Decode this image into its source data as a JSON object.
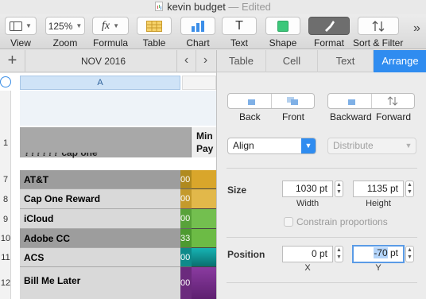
{
  "window": {
    "title": "kevin budget",
    "status": "Edited"
  },
  "toolbar": {
    "view": "View",
    "zoom_value": "125%",
    "zoom": "Zoom",
    "formula": "Formula",
    "formula_glyph": "fx",
    "table": "Table",
    "chart": "Chart",
    "text": "Text",
    "text_glyph": "T",
    "shape": "Shape",
    "format": "Format",
    "sort_filter": "Sort & Filter",
    "overflow": "»"
  },
  "sheet_tabs": {
    "add": "+",
    "active": "NOV 2016",
    "prev": "‹",
    "next": "›"
  },
  "table": {
    "column_a": "A",
    "min_pay_header": "Min Pay",
    "cut_row_text": "?????? cap one",
    "rows": [
      {
        "num": "1",
        "name": "",
        "b": ""
      },
      {
        "num": "7",
        "name": "AT&T",
        "b": "00"
      },
      {
        "num": "8",
        "name": "Cap One Reward",
        "b": "00"
      },
      {
        "num": "9",
        "name": "iCloud",
        "b": "00"
      },
      {
        "num": "10",
        "name": "Adobe CC",
        "b": "33"
      },
      {
        "num": "11",
        "name": "ACS",
        "b": "00"
      },
      {
        "num": "12",
        "name": "Bill Me Later",
        "b": "00"
      }
    ]
  },
  "inspector": {
    "tabs": [
      "Table",
      "Cell",
      "Text",
      "Arrange"
    ],
    "active_tab": "Arrange",
    "back": "Back",
    "front": "Front",
    "backward": "Backward",
    "forward": "Forward",
    "align": "Align",
    "distribute": "Distribute",
    "size_label": "Size",
    "width_value": "1030 pt",
    "height_value": "1135 pt",
    "width_label": "Width",
    "height_label": "Height",
    "constrain": "Constrain proportions",
    "position_label": "Position",
    "x_value": "0 pt",
    "y_value_selected": "-70",
    "y_value_unit": " pt",
    "x_label": "X",
    "y_label": "Y"
  }
}
